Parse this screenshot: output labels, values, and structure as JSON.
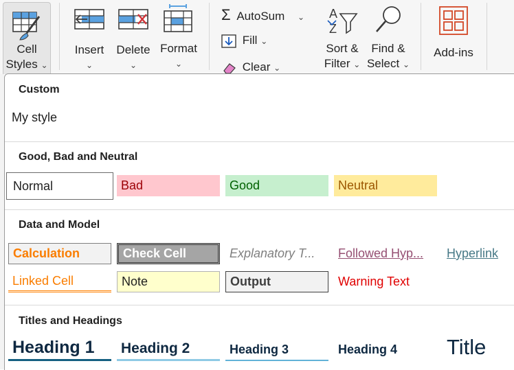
{
  "ribbon": {
    "cell_styles": {
      "line1": "Cell",
      "line2": "Styles",
      "chev": "⌄"
    },
    "insert": {
      "label": "Insert",
      "chev": "⌄"
    },
    "delete": {
      "label": "Delete",
      "chev": "⌄"
    },
    "format": {
      "label": "Format",
      "chev": "⌄"
    },
    "autosum": {
      "label": "AutoSum",
      "glyph": "Σ",
      "chev": "⌄"
    },
    "fill": {
      "label": "Fill",
      "chev": "⌄"
    },
    "clear": {
      "label": "Clear",
      "chev": "⌄"
    },
    "sort_filter": {
      "line1": "Sort &",
      "line2": "Filter",
      "chev": "⌄"
    },
    "find_select": {
      "line1": "Find &",
      "line2": "Select",
      "chev": "⌄"
    },
    "addins": {
      "label": "Add-ins"
    }
  },
  "gallery": {
    "custom": {
      "header": "Custom",
      "items": [
        "My style"
      ]
    },
    "good_bad": {
      "header": "Good, Bad and Neutral",
      "items": [
        "Normal",
        "Bad",
        "Good",
        "Neutral"
      ]
    },
    "data_model": {
      "header": "Data and Model",
      "row1": [
        "Calculation",
        "Check Cell",
        "Explanatory T...",
        "Followed Hyp...",
        "Hyperlink"
      ],
      "row2": [
        "Linked Cell",
        "Note",
        "Output",
        "Warning Text"
      ]
    },
    "titles": {
      "header": "Titles and Headings",
      "items": [
        "Heading 1",
        "Heading 2",
        "Heading 3",
        "Heading 4",
        "Title"
      ]
    }
  },
  "colors": {
    "accent": "#185abd",
    "bad_fill": "#ffc7ce",
    "good_fill": "#c6efce",
    "neutral_fill": "#ffeb9c",
    "addins": "#d24726"
  }
}
